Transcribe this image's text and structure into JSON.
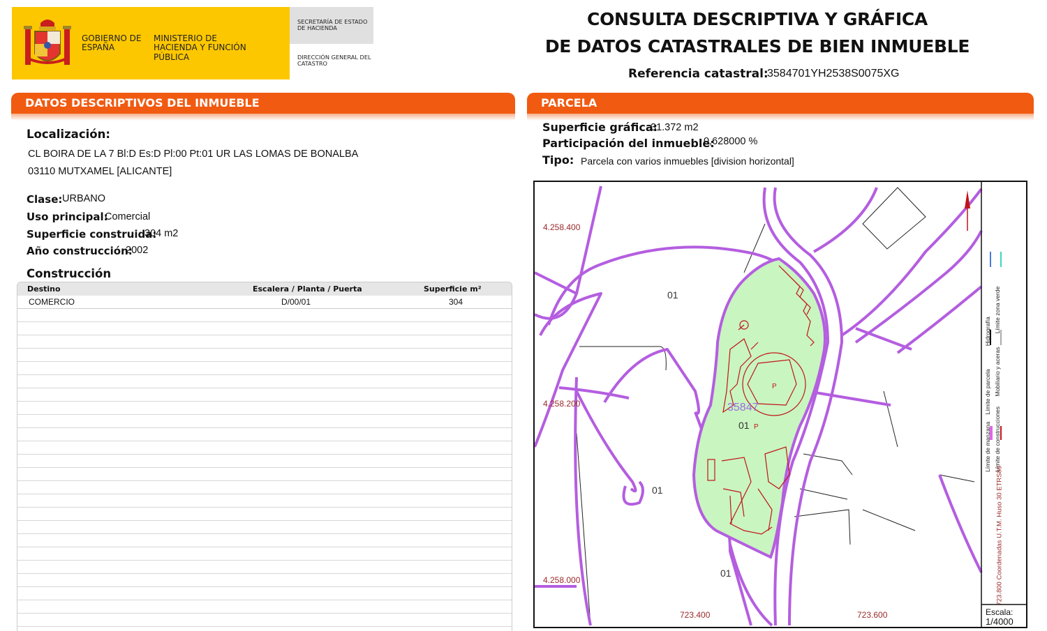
{
  "header": {
    "gobierno": "GOBIERNO DE ESPAÑA",
    "ministerio": "MINISTERIO DE HACIENDA Y FUNCIÓN PÚBLICA",
    "secretaria": "SECRETARÍA DE ESTADO DE HACIENDA",
    "direccion": "DIRECCIÓN GENERAL DEL CATASTRO",
    "title_line1": "CONSULTA DESCRIPTIVA Y GRÁFICA",
    "title_line2": "DE DATOS CATASTRALES DE BIEN INMUEBLE",
    "ref_label": "Referencia catastral:",
    "ref_value": "3584701YH2538S0075XG",
    "brand_yellow": "#fdc700",
    "accent_orange": "#f15a11"
  },
  "descriptivos": {
    "section_prefix": "DATOS DESCRIPTIVOS DEL",
    "section_bold": "INMUEBLE",
    "localizacion_label": "Localización:",
    "address_line1": "CL BOIRA DE LA 7 Bl:D Es:D Pl:00 Pt:01 UR LAS LOMAS DE BONALBA",
    "address_line2": "03110 MUTXAMEL [ALICANTE]",
    "clase_label": "Clase:",
    "clase_value": "URBANO",
    "uso_label": "Uso principal:",
    "uso_value": "Comercial",
    "superficie_label": "Superficie construida:",
    "superficie_value": "304 m2",
    "anio_label": "Año construcción:",
    "anio_value": "2002",
    "construccion_label": "Construcción",
    "table": {
      "headers": [
        "Destino",
        "Escalera / Planta / Puerta",
        "Superficie m²"
      ],
      "rows": [
        [
          "COMERCIO",
          "D/00/01",
          "304"
        ]
      ]
    }
  },
  "parcela": {
    "section_title": "PARCELA",
    "sup_grafica_label": "Superficie gráfica:",
    "sup_grafica_value": "31.372 m2",
    "participacion_label": "Participación del inmueble:",
    "participacion_value": "0,628000 %",
    "tipo_label": "Tipo:",
    "tipo_value": "Parcela con varios inmuebles [division horizontal]"
  },
  "map": {
    "y_coords": [
      "4.258.400",
      "4.258.200",
      "4.258.000"
    ],
    "x_coords": [
      "723.400",
      "723.600",
      "723.800"
    ],
    "labels": [
      "01",
      "01",
      "01",
      "01",
      "01",
      "35847",
      "P",
      "P"
    ],
    "legend_items": [
      "Límite de manzana",
      "Límite de construcciones",
      "Límite de parcela",
      "Mobiliario y aceras",
      "Hidrografía",
      "Límite zona verde"
    ],
    "projection": "Coordenadas U.T.M. Huso 30 ETRS89",
    "scale_label": "Escala:",
    "scale_value": "1/4000",
    "colors": {
      "street": "#b45ee0",
      "parcel_fill": "#c9f5c0",
      "building": "#c0141a",
      "coord_text": "#9b2a2a"
    }
  }
}
